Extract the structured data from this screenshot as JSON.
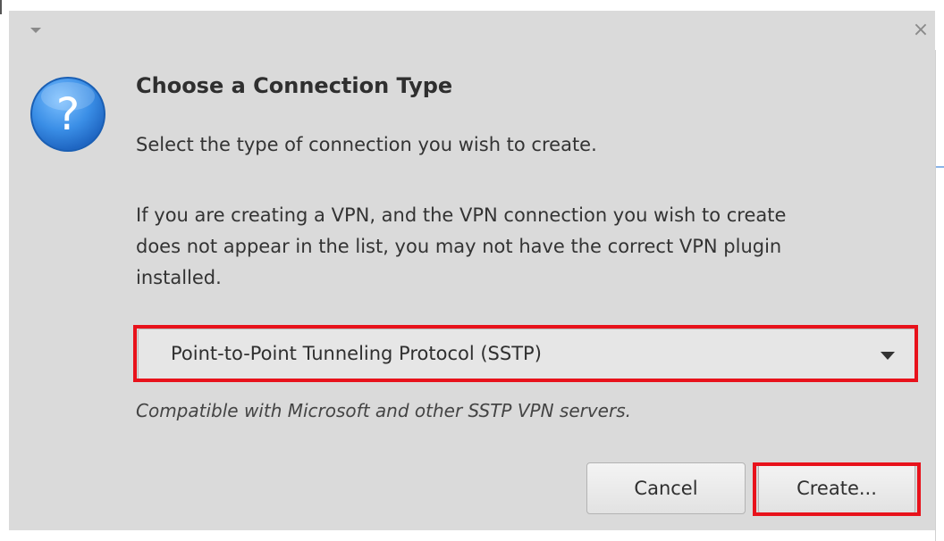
{
  "window": {
    "close_symbol": "×"
  },
  "dialog": {
    "title": "Choose a Connection Type",
    "subtitle": "Select the type of connection you wish to create.",
    "description_lines": [
      "If you are creating a VPN, and the VPN connection you wish to create",
      "does not appear in the list, you may not have the correct VPN plugin",
      "installed."
    ],
    "connection_type": {
      "selected": "Point-to-Point Tunneling Protocol (SSTP)",
      "description": "Compatible with Microsoft and other SSTP VPN servers."
    },
    "buttons": {
      "cancel": "Cancel",
      "create": "Create..."
    }
  },
  "icons": {
    "dialog": "question-icon",
    "window_menu": "dropdown-triangle-icon",
    "close": "close-icon",
    "combo_arrow": "chevron-down-icon"
  },
  "colors": {
    "dialog_bg": "#dadada",
    "highlight": "#e8121b",
    "icon_blue": "#3a8ee6"
  }
}
